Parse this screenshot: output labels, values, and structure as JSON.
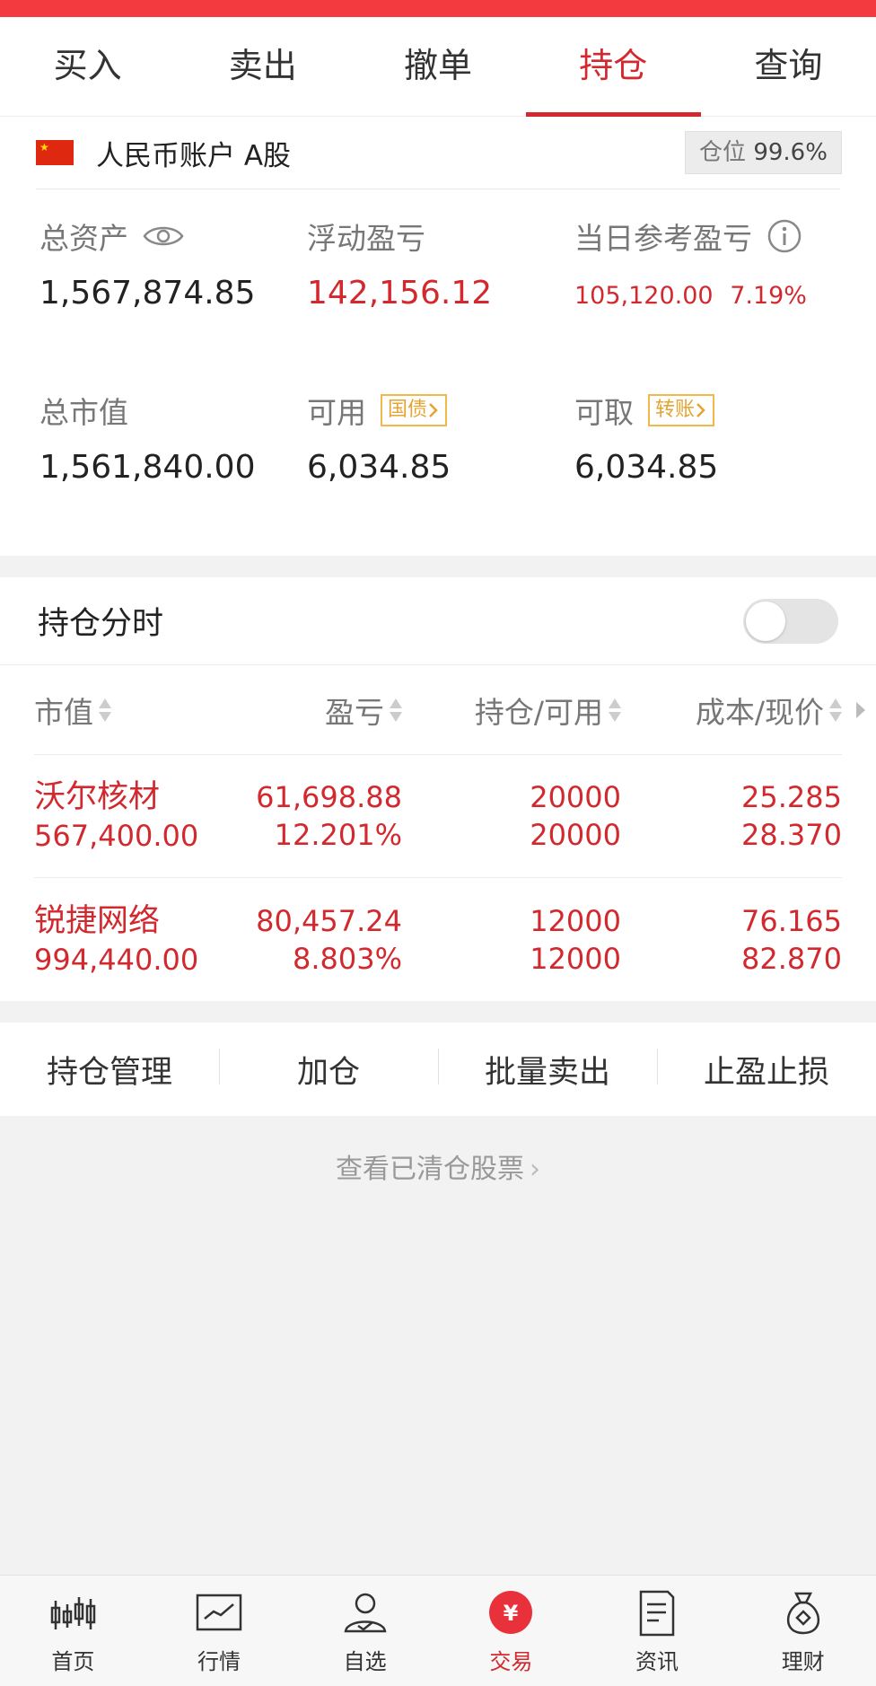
{
  "tabs": [
    "买入",
    "卖出",
    "撤单",
    "持仓",
    "查询"
  ],
  "active_tab": "持仓",
  "account": {
    "name": "人民币账户 A股",
    "position_label": "仓位",
    "position_value": "99.6%"
  },
  "summary": {
    "total_assets_label": "总资产",
    "total_assets": "1,567,874.85",
    "floating_pl_label": "浮动盈亏",
    "floating_pl": "142,156.12",
    "daily_pl_label": "当日参考盈亏",
    "daily_pl": "105,120.00",
    "daily_pl_pct": "7.19%",
    "market_value_label": "总市值",
    "market_value": "1,561,840.00",
    "available_label": "可用",
    "available_tag": "国债",
    "available": "6,034.85",
    "withdrawable_label": "可取",
    "withdrawable_tag": "转账",
    "withdrawable": "6,034.85"
  },
  "holding_timeline": {
    "title": "持仓分时",
    "toggle_on": false
  },
  "table": {
    "headers": [
      "市值",
      "盈亏",
      "持仓/可用",
      "成本/现价"
    ],
    "rows": [
      {
        "name": "沃尔核材",
        "market_value": "567,400.00",
        "pl": "61,698.88",
        "pl_pct": "12.201%",
        "holding": "20000",
        "available": "20000",
        "cost": "25.285",
        "price": "28.370"
      },
      {
        "name": "锐捷网络",
        "market_value": "994,440.00",
        "pl": "80,457.24",
        "pl_pct": "8.803%",
        "holding": "12000",
        "available": "12000",
        "cost": "76.165",
        "price": "82.870"
      }
    ]
  },
  "actions": [
    "持仓管理",
    "加仓",
    "批量卖出",
    "止盈止损"
  ],
  "cleared_link": "查看已清仓股票",
  "bottom_nav": [
    {
      "label": "首页",
      "icon": "candlestick-icon"
    },
    {
      "label": "行情",
      "icon": "chart-icon"
    },
    {
      "label": "自选",
      "icon": "user-check-icon"
    },
    {
      "label": "交易",
      "icon": "yuan-icon"
    },
    {
      "label": "资讯",
      "icon": "document-icon"
    },
    {
      "label": "理财",
      "icon": "money-bag-icon"
    }
  ],
  "active_nav": "交易"
}
